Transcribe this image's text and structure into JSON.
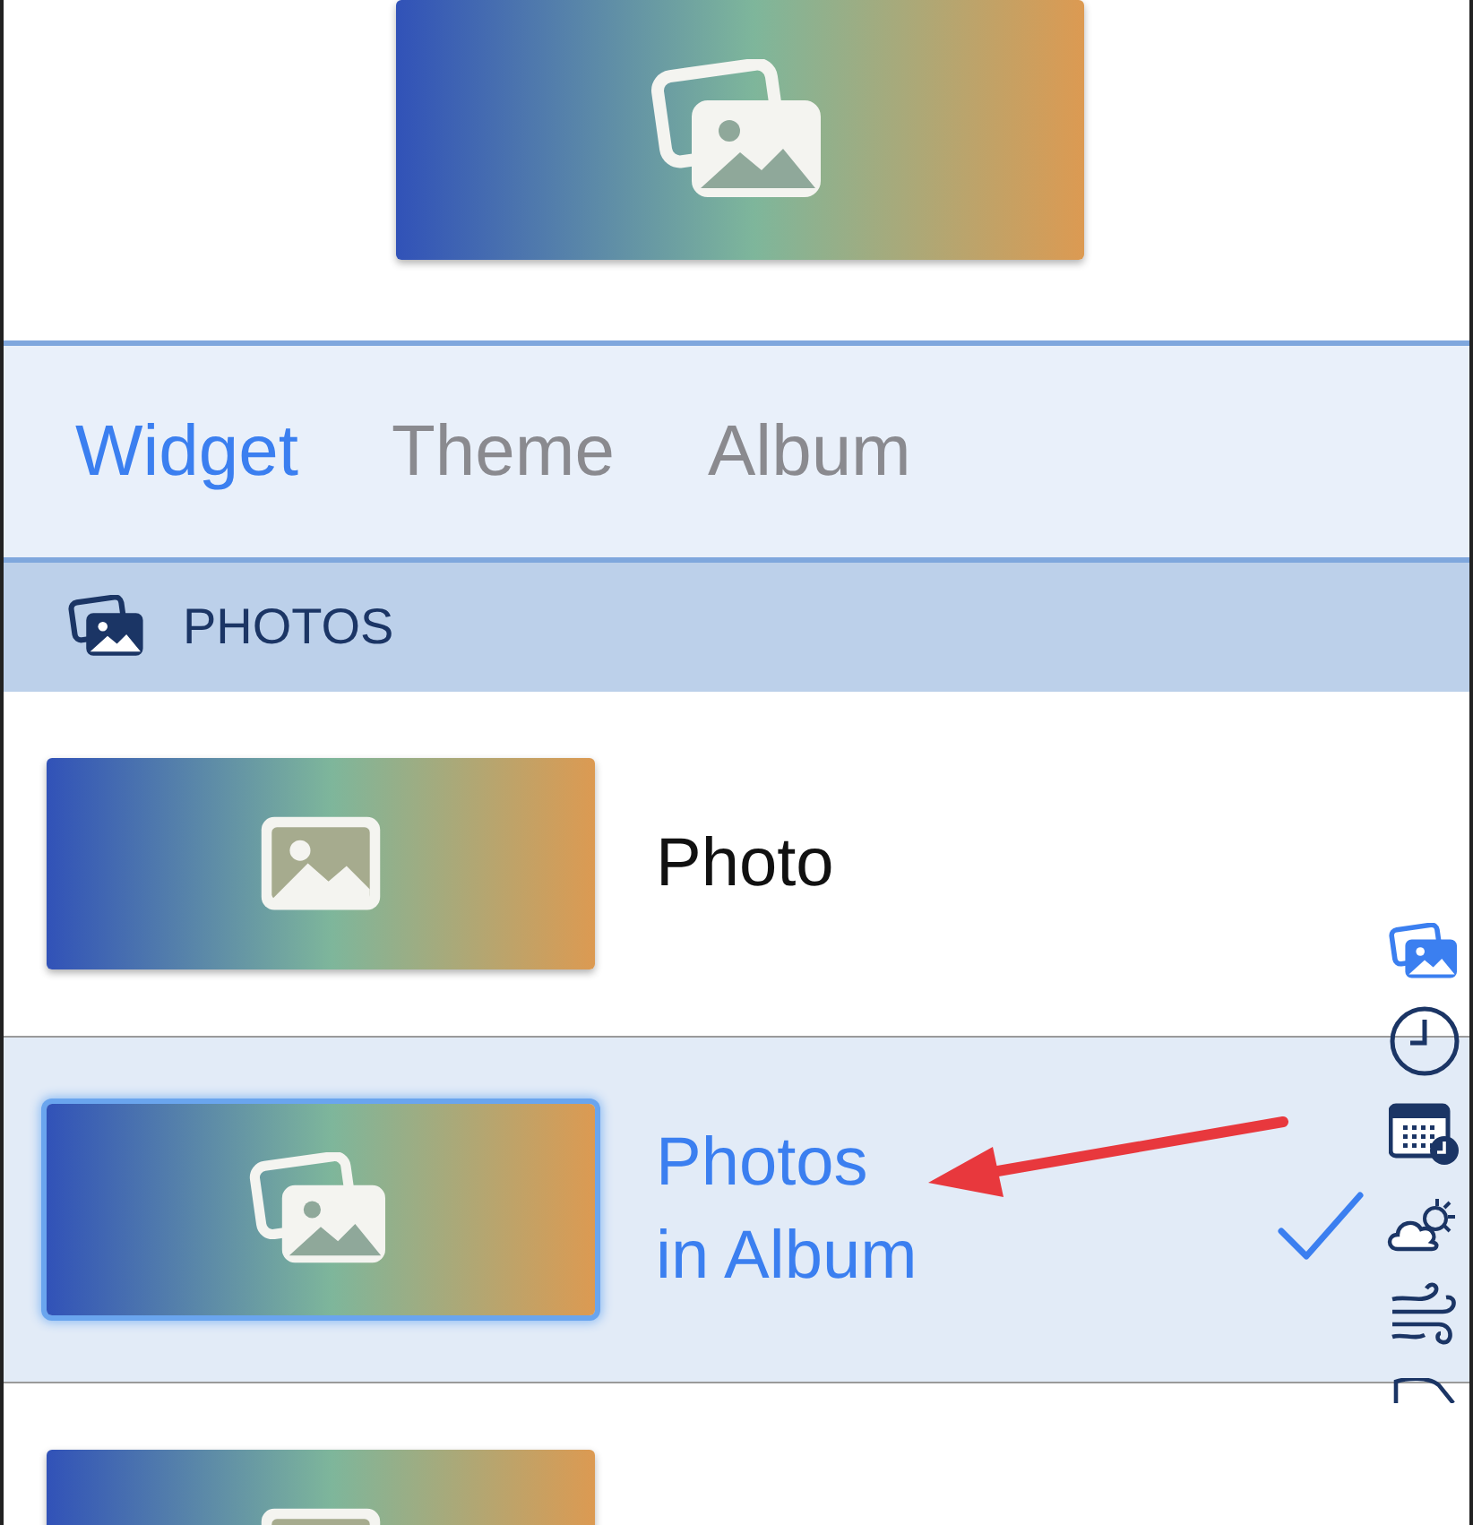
{
  "preview": {
    "kind": "photos"
  },
  "tabs": [
    {
      "label": "Widget",
      "selected": true
    },
    {
      "label": "Theme",
      "selected": false
    },
    {
      "label": "Album",
      "selected": false
    }
  ],
  "section": {
    "title": "PHOTOS"
  },
  "rows": [
    {
      "kind": "photo",
      "title": "Photo",
      "selected": false
    },
    {
      "kind": "photos",
      "title": "Photos\nin Album",
      "selected": true
    },
    {
      "kind": "photo",
      "selected": false
    }
  ],
  "side_index": [
    {
      "kind": "photos",
      "selected": true
    },
    {
      "kind": "clock",
      "selected": false
    },
    {
      "kind": "calendar",
      "selected": false
    },
    {
      "kind": "weather",
      "selected": false
    },
    {
      "kind": "wind",
      "selected": false
    },
    {
      "kind": "more",
      "selected": false
    }
  ],
  "annotation": {
    "kind": "arrow"
  }
}
